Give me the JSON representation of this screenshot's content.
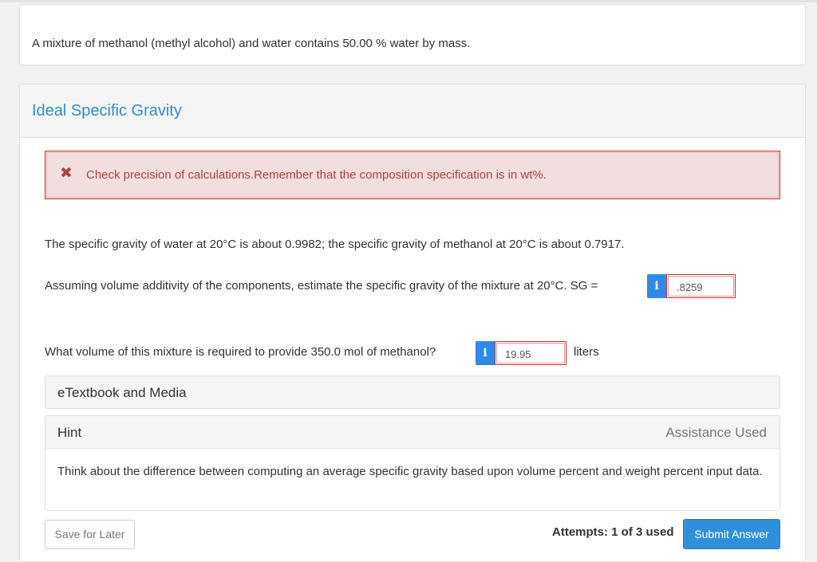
{
  "intro": {
    "text": "A mixture of methanol (methyl alcohol) and water contains 50.00 % water by mass."
  },
  "section": {
    "title": "Ideal Specific Gravity"
  },
  "alert": {
    "icon": "close-x-icon",
    "icon_glyph": "✖",
    "message": "Check precision of calculations.Remember that the composition specification is in wt%."
  },
  "question": {
    "given_text": "The specific gravity of water at 20°C is about 0.9982; the specific gravity of methanol at 20°C is about 0.7917.",
    "sg_prompt": "Assuming volume additivity of the components, estimate the specific gravity of the mixture at 20°C. SG =",
    "sg_answer": ".8259",
    "volume_prompt": "What volume of this mixture is required to provide 350.0 mol of methanol?",
    "volume_answer": "19.95",
    "volume_unit": "liters",
    "info_glyph": "i"
  },
  "etextbook": {
    "label": "eTextbook and Media"
  },
  "hint": {
    "title": "Hint",
    "status": "Assistance Used",
    "body": "Think about the difference between computing an average specific gravity based upon volume percent and weight percent input data."
  },
  "footer": {
    "save_label": "Save for Later",
    "attempts": "Attempts: 1 of 3 used",
    "submit_label": "Submit Answer"
  },
  "colors": {
    "accent": "#2f8fcf",
    "alert_text": "#a94442",
    "alert_bg": "#f2dede",
    "alert_border": "#c9302c",
    "button_primary": "#2f8fdb"
  }
}
